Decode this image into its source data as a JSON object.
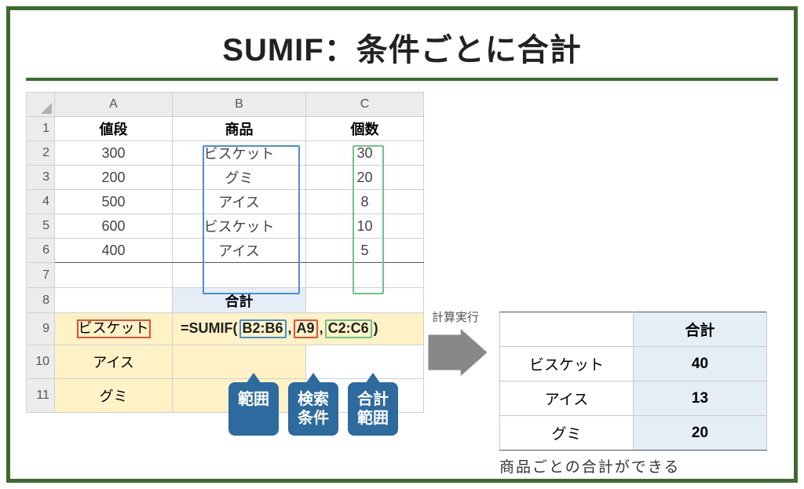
{
  "title": "SUMIF：条件ごとに合計",
  "columns": {
    "A": "A",
    "B": "B",
    "C": "C"
  },
  "headers": {
    "price": "値段",
    "product": "商品",
    "qty": "個数"
  },
  "rows": [
    {
      "n": "1"
    },
    {
      "n": "2",
      "A": "300",
      "B": "ビスケット",
      "C": "30"
    },
    {
      "n": "3",
      "A": "200",
      "B": "グミ",
      "C": "20"
    },
    {
      "n": "4",
      "A": "500",
      "B": "アイス",
      "C": "8"
    },
    {
      "n": "5",
      "A": "600",
      "B": "ビスケット",
      "C": "10"
    },
    {
      "n": "6",
      "A": "400",
      "B": "アイス",
      "C": "5"
    },
    {
      "n": "7"
    },
    {
      "n": "8"
    },
    {
      "n": "9",
      "A": "ビスケット"
    },
    {
      "n": "10",
      "A": "アイス"
    },
    {
      "n": "11",
      "A": "グミ"
    }
  ],
  "sum_header": "合計",
  "formula": {
    "prefix": "=SUMIF(",
    "range": "B2:B6",
    "criteria": "A9",
    "sum_range": "C2:C6",
    "suffix": ")",
    "sep": ","
  },
  "callouts": {
    "range": "範囲",
    "criteria": "検索\n条件",
    "sum_range": "合計\n範囲"
  },
  "exec_label": "計算実行",
  "result_header": "合計",
  "results": [
    {
      "name": "ビスケット",
      "val": "40"
    },
    {
      "name": "アイス",
      "val": "13"
    },
    {
      "name": "グミ",
      "val": "20"
    }
  ],
  "caption": "商品ごとの合計ができる"
}
